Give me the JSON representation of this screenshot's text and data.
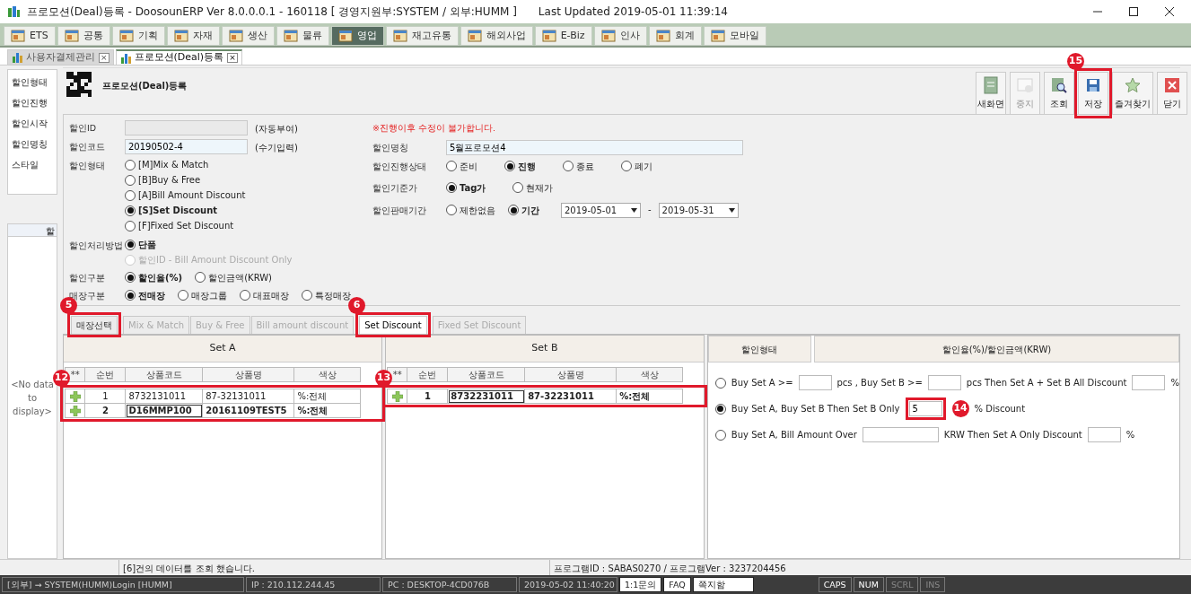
{
  "window": {
    "title": "프로모션(Deal)등록 - DoosounERP Ver 8.0.0.0.1 - 160118 [ 경영지원부:SYSTEM / 외부:HUMM ]",
    "last_updated": "Last Updated 2019-05-01 11:39:14"
  },
  "modules": [
    {
      "label": "ETS",
      "selected": false
    },
    {
      "label": "공통",
      "selected": false
    },
    {
      "label": "기획",
      "selected": false
    },
    {
      "label": "자재",
      "selected": false
    },
    {
      "label": "생산",
      "selected": false
    },
    {
      "label": "물류",
      "selected": false
    },
    {
      "label": "영업",
      "selected": true
    },
    {
      "label": "재고유통",
      "selected": false
    },
    {
      "label": "해외사업",
      "selected": false
    },
    {
      "label": "E-Biz",
      "selected": false
    },
    {
      "label": "인사",
      "selected": false
    },
    {
      "label": "회계",
      "selected": false
    },
    {
      "label": "모바일",
      "selected": false
    }
  ],
  "doc_tabs": [
    {
      "label": "사용자결제관리",
      "selected": false,
      "close": "×"
    },
    {
      "label": "프로모션(Deal)등록",
      "selected": true,
      "close": "×"
    }
  ],
  "page_title": "프로모션(Deal)등록",
  "toolbar": [
    {
      "label": "새화면",
      "kind": "new",
      "disabled": false
    },
    {
      "label": "중지",
      "kind": "stop",
      "disabled": true
    },
    {
      "label": "조회",
      "kind": "search",
      "disabled": false
    },
    {
      "label": "저장",
      "kind": "save",
      "disabled": false,
      "callout": "15"
    },
    {
      "label": "즐겨찾기",
      "kind": "favorite",
      "disabled": false
    },
    {
      "label": "닫기",
      "kind": "close",
      "disabled": false
    }
  ],
  "sidebar": {
    "items": [
      "할인형태",
      "할인진행",
      "할인시작",
      "할인명칭",
      "스타일"
    ],
    "grid_header": "할",
    "empty_text": "<No data to display>"
  },
  "form_left": [
    {
      "label": "할인ID",
      "kind": "text",
      "disabled": true,
      "note": "(자동부여)"
    },
    {
      "label": "할인코드",
      "kind": "text",
      "disabled": false,
      "value": "20190502-4",
      "note": "(수기입력)"
    },
    {
      "label": "할인형태",
      "kind": "radio_column",
      "options": [
        {
          "text": "[M]Mix & Match",
          "selected": false,
          "disabled": false
        },
        {
          "text": "[B]Buy & Free",
          "selected": false,
          "disabled": false
        },
        {
          "text": "[A]Bill Amount Discount",
          "selected": false,
          "disabled": false
        },
        {
          "text": "[S]Set Discount",
          "selected": true,
          "disabled": false
        },
        {
          "text": "[F]Fixed Set Discount",
          "selected": false,
          "disabled": false
        }
      ]
    },
    {
      "label": "할인처리방법",
      "kind": "radio_column",
      "options": [
        {
          "text": "단품",
          "selected": true,
          "disabled": false
        },
        {
          "text": "할인ID - Bill Amount Discount Only",
          "selected": false,
          "disabled": true
        }
      ]
    },
    {
      "label": "할인구분",
      "kind": "radio_row",
      "options": [
        {
          "text": "할인율(%)",
          "selected": true,
          "disabled": false
        },
        {
          "text": "할인금액(KRW)",
          "selected": false,
          "disabled": false
        }
      ]
    },
    {
      "label": "매장구분",
      "kind": "radio_row",
      "options": [
        {
          "text": "전매장",
          "selected": true,
          "disabled": false
        },
        {
          "text": "매장그룹",
          "selected": false,
          "disabled": false
        },
        {
          "text": "대표매장",
          "selected": false,
          "disabled": false
        },
        {
          "text": "특정매장",
          "selected": false,
          "disabled": false
        }
      ]
    }
  ],
  "notice": "※진행이후 수정이 불가합니다.",
  "form_right": [
    {
      "label": "할인명칭",
      "kind": "text",
      "disabled": false,
      "value": "5월프로모션4"
    },
    {
      "label": "할인진행상태",
      "kind": "radio_row",
      "options": [
        {
          "text": "준비",
          "selected": false,
          "disabled": false
        },
        {
          "text": "진행",
          "selected": true,
          "disabled": false
        },
        {
          "text": "종료",
          "selected": false,
          "disabled": false
        },
        {
          "text": "폐기",
          "selected": false,
          "disabled": false
        }
      ]
    },
    {
      "label": "할인기준가",
      "kind": "radio_row",
      "options": [
        {
          "text": "Tag가",
          "selected": true,
          "disabled": false
        },
        {
          "text": "현재가",
          "selected": false,
          "disabled": false
        }
      ]
    },
    {
      "label": "할인판매기간",
      "kind": "radio_dates",
      "options": [
        {
          "text": "제한없음",
          "selected": false,
          "disabled": false
        },
        {
          "text": "기간",
          "selected": true,
          "disabled": false
        }
      ],
      "date_from": "2019-05-01",
      "date_sep": "-",
      "date_to": "2019-05-31"
    }
  ],
  "sub_tabs": [
    {
      "label": "매장선택",
      "selected": false,
      "disabled": false,
      "callout": "5"
    },
    {
      "label": "Mix & Match",
      "selected": false,
      "disabled": true
    },
    {
      "label": "Buy & Free",
      "selected": false,
      "disabled": true
    },
    {
      "label": "Bill amount discount",
      "selected": false,
      "disabled": true
    },
    {
      "label": "Set Discount",
      "selected": true,
      "disabled": false,
      "callout": "6"
    },
    {
      "label": "Fixed Set Discount",
      "selected": false,
      "disabled": true
    }
  ],
  "sets": [
    {
      "title": "Set A",
      "callout": "12",
      "columns": [
        "**",
        "순번",
        "상품코드",
        "상품명",
        "색상"
      ],
      "rows": [
        {
          "focused": false,
          "cells": [
            "",
            "1",
            "8732131011",
            "87-32131011",
            "%:전체"
          ]
        },
        {
          "focused": true,
          "cells": [
            "",
            "2",
            "D16MMP100",
            "20161109TEST5",
            "%:전체"
          ]
        }
      ]
    },
    {
      "title": "Set B",
      "callout": "13",
      "columns": [
        "**",
        "순번",
        "상품코드",
        "상품명",
        "색상"
      ],
      "rows": [
        {
          "focused": true,
          "cells": [
            "",
            "1",
            "8732231011",
            "87-32231011",
            "%:전체"
          ]
        }
      ]
    }
  ],
  "discount_panel": {
    "columns": [
      "할인형태",
      "할인율(%)/할인금액(KRW)"
    ],
    "options": [
      {
        "selected": false,
        "parts": [
          {
            "kind": "text",
            "text": "Buy Set A >="
          },
          {
            "kind": "field"
          },
          {
            "kind": "text",
            "text": "pcs , Buy Set B >="
          },
          {
            "kind": "field"
          },
          {
            "kind": "text",
            "text": "pcs Then Set A + Set B All Discount"
          },
          {
            "kind": "field"
          },
          {
            "kind": "text",
            "text": "%"
          }
        ]
      },
      {
        "selected": true,
        "parts": [
          {
            "kind": "text",
            "text": "Buy Set A, Buy Set B Then Set B Only"
          },
          {
            "kind": "field",
            "value": "5",
            "callout": "14"
          },
          {
            "kind": "text",
            "text": "% Discount"
          }
        ]
      },
      {
        "selected": false,
        "parts": [
          {
            "kind": "text",
            "text": "Buy Set A, Bill Amount Over"
          },
          {
            "kind": "field",
            "wide": true
          },
          {
            "kind": "text",
            "text": "KRW Then Set A Only Discount"
          },
          {
            "kind": "field"
          },
          {
            "kind": "text",
            "text": "%"
          }
        ]
      }
    ]
  },
  "status_bar": {
    "message": "[6]건의 데이터를 조회 했습니다.",
    "program_info": "프로그램ID : SABAS0270 / 프로그램Ver : 3237204456"
  },
  "bottom_bar": [
    {
      "text": "[외부] → SYSTEM(HUMM)Login [HUMM]",
      "kind": "info"
    },
    {
      "text": "IP : 210.112.244.45",
      "kind": "info"
    },
    {
      "text": "PC : DESKTOP-4CD076B",
      "kind": "info"
    },
    {
      "text": "2019-05-02 11:40:20",
      "kind": "info"
    },
    {
      "text": "1:1문의",
      "kind": "button"
    },
    {
      "text": "FAQ",
      "kind": "button"
    },
    {
      "text": "쪽지함",
      "kind": "button"
    },
    {
      "text": "CAPS",
      "kind": "key"
    },
    {
      "text": "NUM",
      "kind": "key"
    },
    {
      "text": "SCRL",
      "kind": "key_off"
    },
    {
      "text": "INS",
      "kind": "key_off"
    }
  ]
}
